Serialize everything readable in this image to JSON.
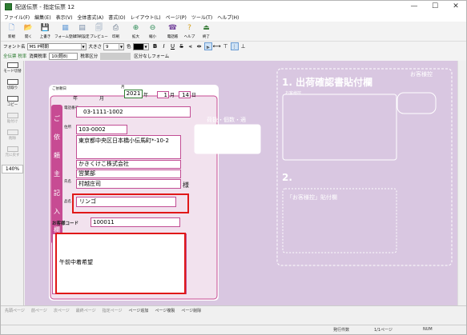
{
  "window": {
    "title": "配送伝票 - 指定伝票 12",
    "min": "—",
    "max": "☐",
    "close": "✕"
  },
  "menu": [
    "ファイル(F)",
    "編集(E)",
    "表示(V)",
    "全体書式(A)",
    "書式(O)",
    "レイアウト(L)",
    "ページ(P)",
    "ツール(T)",
    "ヘルプ(H)"
  ],
  "toolbar": [
    {
      "label": "新規",
      "icon": "new-doc-icon",
      "glyph": "🗋",
      "color": "#5b8fd6"
    },
    {
      "label": "開く",
      "icon": "open-folder-icon",
      "glyph": "📂",
      "color": "#e0b24a"
    },
    {
      "label": "上書き",
      "icon": "save-icon",
      "glyph": "💾",
      "color": "#3b6fb8"
    },
    {
      "label": "フォーム登録",
      "icon": "form-register-icon",
      "glyph": "▦",
      "color": "#6fa2d8"
    },
    {
      "label": "印刷設定",
      "icon": "print-settings-icon",
      "glyph": "▤",
      "color": "#7a8ea8"
    },
    {
      "label": "プレビュー",
      "icon": "preview-icon",
      "glyph": "🗐",
      "color": "#6f87a6"
    },
    {
      "label": "印刷",
      "icon": "print-icon",
      "glyph": "⎙",
      "color": "#5a6b80"
    },
    {
      "label": "拡大",
      "icon": "zoom-in-icon",
      "glyph": "⊕",
      "color": "#2e8b57"
    },
    {
      "label": "縮小",
      "icon": "zoom-out-icon",
      "glyph": "⊖",
      "color": "#2e8b57"
    },
    {
      "label": "電話帳",
      "icon": "phonebook-icon",
      "glyph": "☎",
      "color": "#7a4ca0"
    },
    {
      "label": "ヘルプ",
      "icon": "help-icon",
      "glyph": "?",
      "color": "#d4a017"
    },
    {
      "label": "終了",
      "icon": "exit-icon",
      "glyph": "⏏",
      "color": "#3d7f3d"
    }
  ],
  "fontbar": {
    "font_label": "フォント名",
    "font_value": "MS P明朝",
    "size_label": "大きさ",
    "size_value": "9",
    "color_label": "色"
  },
  "taxbar": {
    "tax_btn": "全伝票 税率",
    "tax_label": "消費税率",
    "tax_value": "10(軽8)",
    "class_label": "税率区分",
    "class_value": "区分なしフォーム"
  },
  "leftpanel": {
    "items": [
      {
        "label": "モード切替",
        "dis": false
      },
      {
        "label": "切取り",
        "dis": false
      },
      {
        "label": "コピー",
        "dis": false
      },
      {
        "label": "貼付け",
        "dis": true
      },
      {
        "label": "削除",
        "dis": true
      },
      {
        "label": "元に戻す",
        "dis": true
      }
    ],
    "zoom": "140%"
  },
  "form": {
    "date_label": "ご依頼日",
    "year_label": "年",
    "month_label": "月",
    "day_label": "日",
    "year": "2021",
    "month": "1",
    "day": "14",
    "date_unit": "月",
    "side_title": [
      "ご",
      "依",
      "頼",
      "主",
      "記",
      "入",
      "欄"
    ],
    "phone_label": "電話番号",
    "phone": "03-1111-1002",
    "address_label": "住所",
    "postal": "103-0002",
    "address": "東京都中央区日本橋小伝馬町*-10-2",
    "company": "かきくけこ株式会社",
    "dept": "営業部",
    "name_label": "氏名",
    "name": "村越庄司",
    "honorific": "様",
    "item_label": "品名",
    "item": "リンゴ",
    "customer_code_label": "お客様コード",
    "customer_code": "100011",
    "note": "午前中着希望",
    "stamp_text": "荷扱・個数・適"
  },
  "right": {
    "title1": "1. 出荷確認書貼付欄",
    "customer_area": "お客様控",
    "receipt": "お客様控",
    "title2": "2.",
    "sticker": "「お客様控」貼付欄"
  },
  "bottombar": [
    "先頭ページ",
    "前ページ",
    "次ページ",
    "最終ページ",
    "指定ページ",
    "ページ追加",
    "ページ複製",
    "ページ削除"
  ],
  "statusbar": {
    "status": "発行件数",
    "page": "1/1ページ",
    "num": "NUM"
  }
}
